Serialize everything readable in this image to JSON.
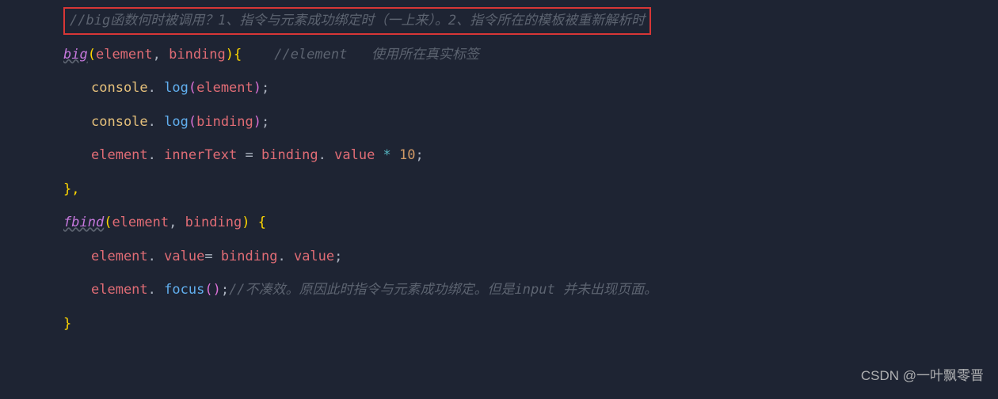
{
  "code": {
    "line1_comment": "//big函数何时被调用？1、指令与元素成功绑定时（一上来）。2、指令所在的模板被重新解析时",
    "line2": {
      "fn": "big",
      "p1": "element",
      "p2": "binding",
      "brace": "{",
      "comment": "//element   使用所在真实标签"
    },
    "line3": {
      "obj": "console",
      "dot": ". ",
      "method": "log",
      "arg": "element",
      "end": ";"
    },
    "line4": {
      "obj": "console",
      "dot": ". ",
      "method": "log",
      "arg": "binding",
      "end": ";"
    },
    "line5": {
      "obj": "element",
      "dot": ". ",
      "prop": "innerText",
      "eq": " = ",
      "obj2": "binding",
      "dot2": ". ",
      "prop2": "value",
      "op": " * ",
      "num": "10",
      "end": ";"
    },
    "line6": "},",
    "line7": {
      "fn": "fbind",
      "p1": "element",
      "p2": "binding",
      "brace": "{"
    },
    "line8": {
      "obj": "element",
      "dot": ". ",
      "prop": "value",
      "eq": "= ",
      "obj2": "binding",
      "dot2": ". ",
      "prop2": "value",
      "end": ";"
    },
    "line9": {
      "obj": "element",
      "dot": ". ",
      "method": "focus",
      "end": ";",
      "comment": "//不凑效。原因此时指令与元素成功绑定。但是input 并未出现页面。"
    },
    "line10": "}"
  },
  "watermark": "CSDN @一叶飘零晋"
}
